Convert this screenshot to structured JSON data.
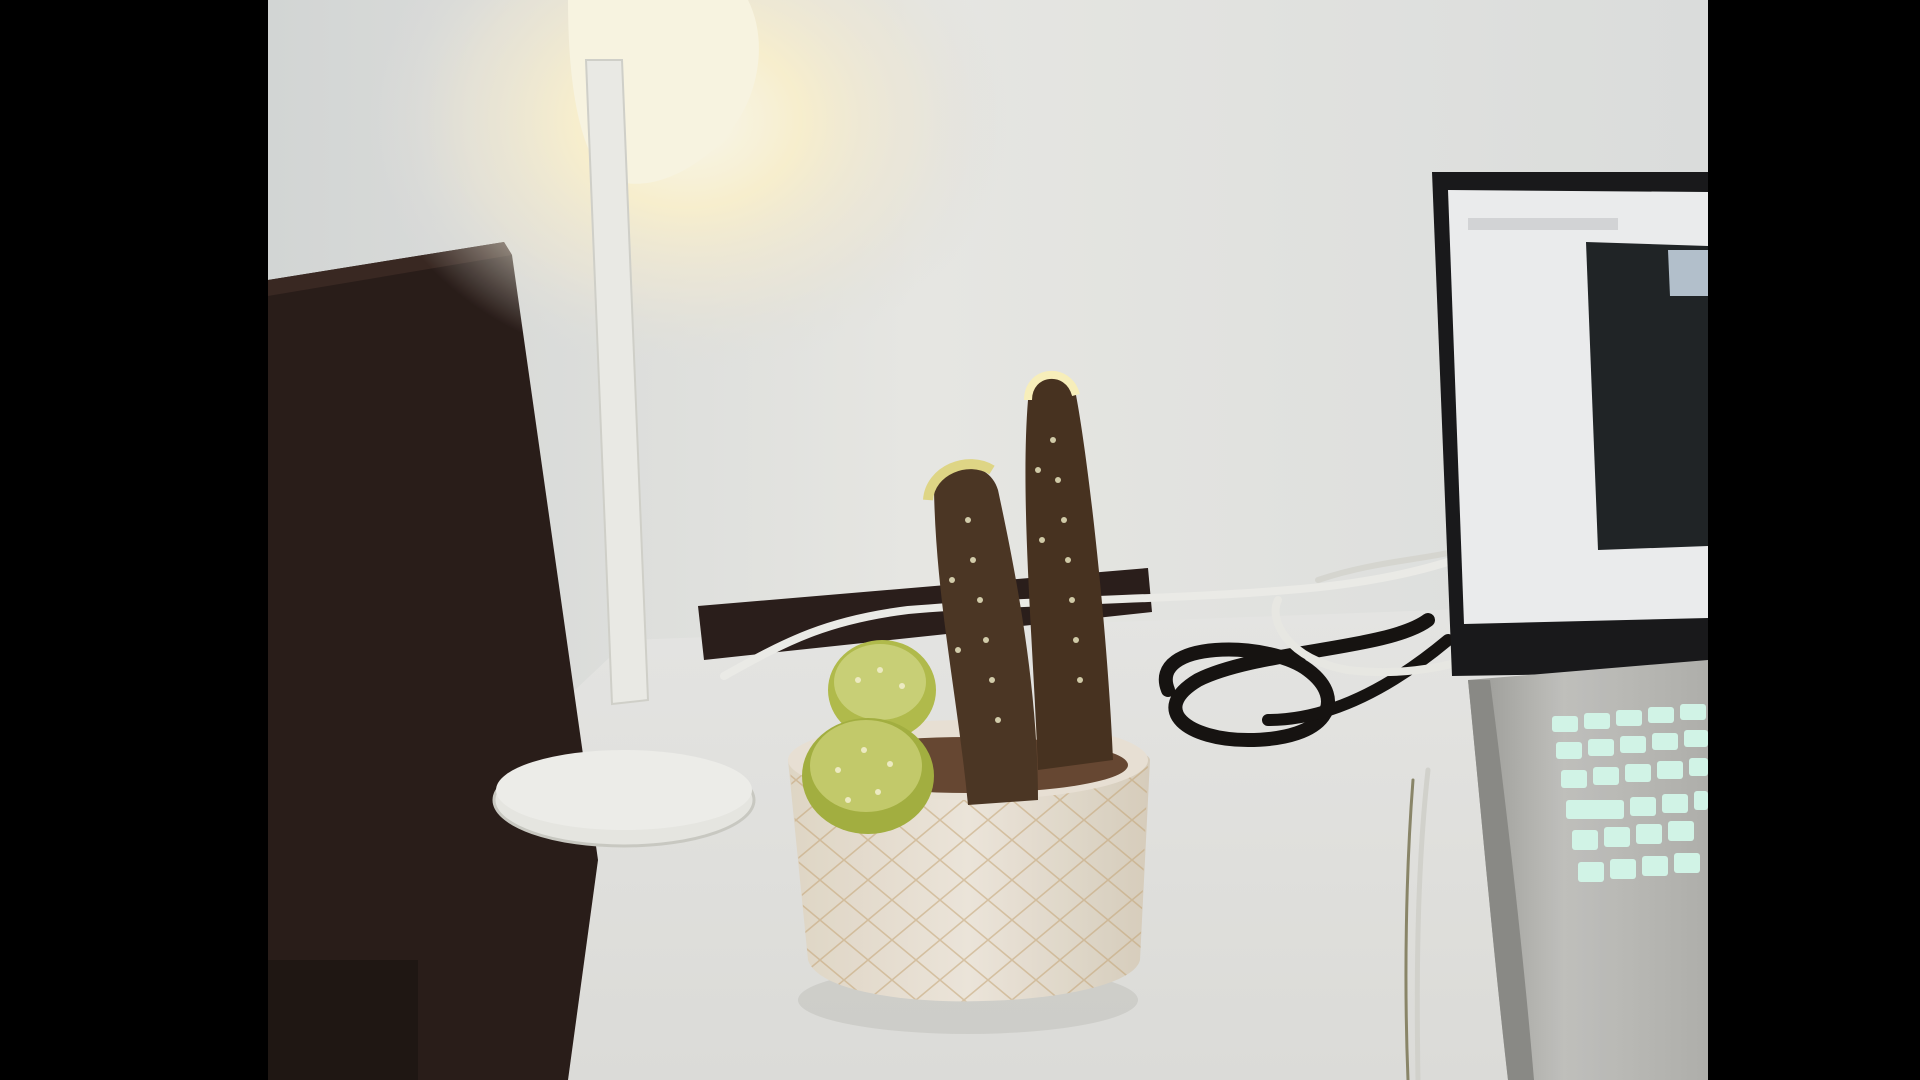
{
  "viewer": {
    "background": "#000000"
  },
  "photo": {
    "subject": "desk-scene",
    "palette": {
      "wall": "#e6e7e3",
      "desk": "#e8e8e4",
      "chair": "#2a1c18",
      "lamp_glow": "#fff6d0",
      "cactus_dark": "#4a3524",
      "cactus_green": "#c8cf6a",
      "pot": "#ede3d3",
      "laptop_body": "#bcbcb8",
      "keyboard_glow": "#d9fbee"
    }
  }
}
